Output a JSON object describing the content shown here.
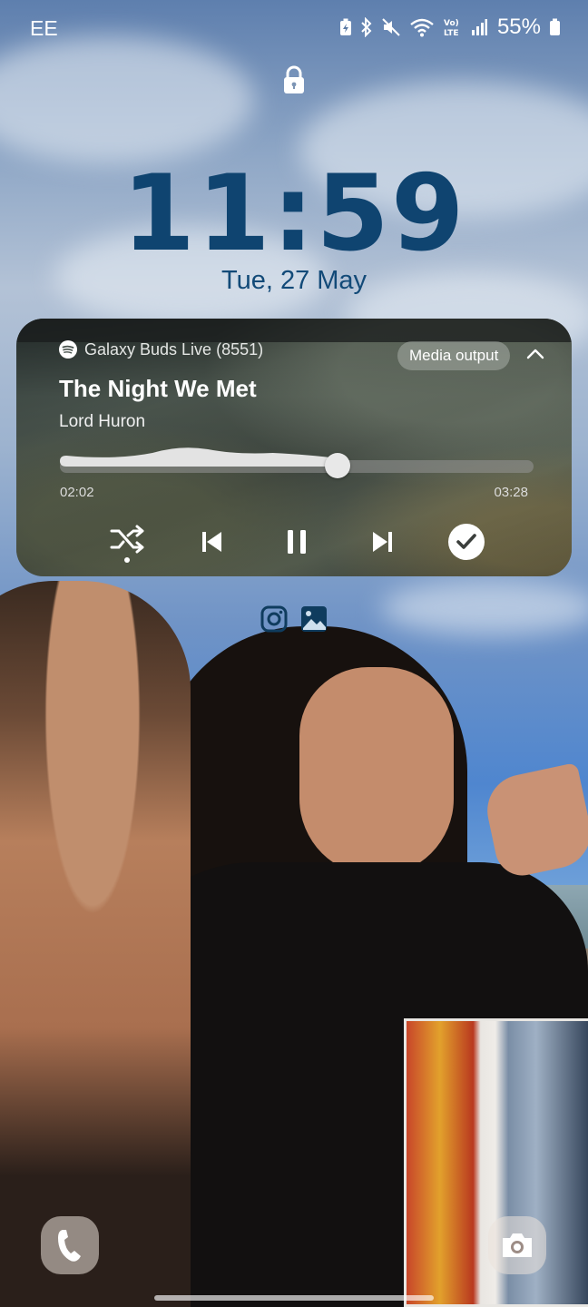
{
  "status_bar": {
    "carrier": "EE",
    "battery_percent": "55%",
    "icons": [
      "battery-saver-icon",
      "bluetooth-icon",
      "mute-icon",
      "wifi-icon",
      "volte-icon",
      "signal-icon",
      "battery-icon"
    ]
  },
  "lock_screen": {
    "time": "11:59",
    "date": "Tue, 27 May"
  },
  "media": {
    "source_icon": "spotify-icon",
    "device_name": "Galaxy Buds Live (8551)",
    "output_button_label": "Media output",
    "track_title": "The Night We Met",
    "artist": "Lord Huron",
    "elapsed": "02:02",
    "duration": "03:28",
    "progress_fraction": 0.586,
    "controls": [
      "shuffle-icon",
      "previous-icon",
      "pause-icon",
      "next-icon",
      "saved-check-icon"
    ]
  },
  "shortcuts": [
    "instagram-icon",
    "gallery-icon"
  ],
  "corner_buttons": [
    "phone-icon",
    "camera-icon"
  ],
  "colors": {
    "clock": "#0f4470",
    "date": "#124a78"
  }
}
